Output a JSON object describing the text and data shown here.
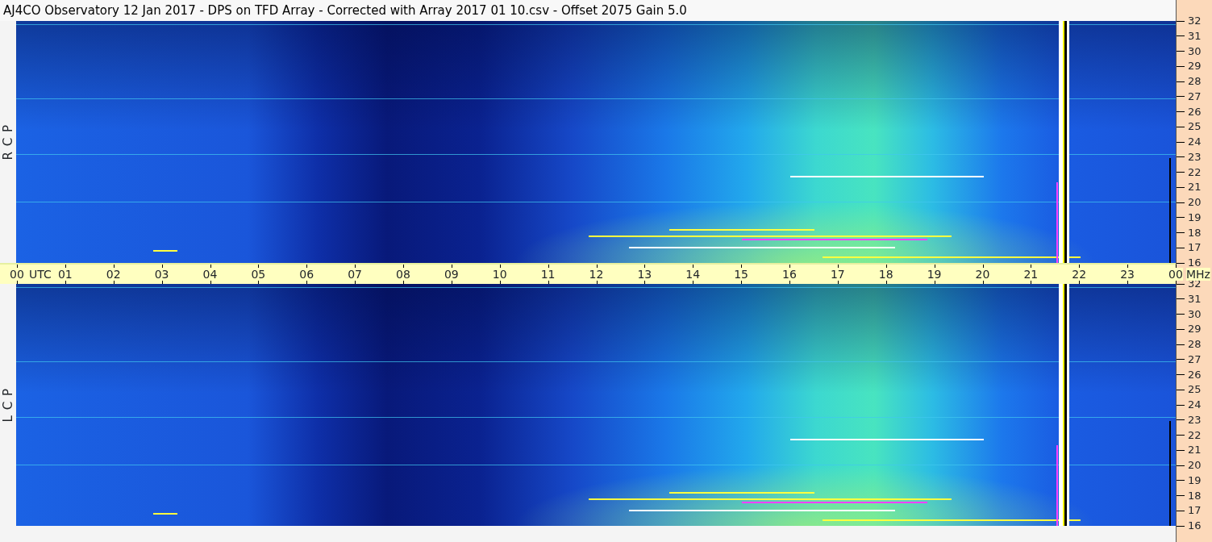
{
  "window": {
    "title": "AJ4CO Observatory  12 Jan 2017  -  DPS on TFD Array  -  Corrected with Array 2017 01 10.csv  -  Offset 2075  Gain 5.0"
  },
  "panels": [
    {
      "label": "R C P",
      "frequency_ticks": [
        "32",
        "31",
        "30",
        "29",
        "28",
        "27",
        "26",
        "25",
        "24",
        "23",
        "22",
        "21",
        "20",
        "19",
        "18",
        "17",
        "16"
      ]
    },
    {
      "label": "L C P",
      "frequency_ticks": [
        "32",
        "31",
        "30",
        "29",
        "28",
        "27",
        "26",
        "25",
        "24",
        "23",
        "22",
        "21",
        "20",
        "19",
        "18",
        "17",
        "16"
      ]
    }
  ],
  "time_axis": {
    "hours": [
      "00",
      "01",
      "02",
      "03",
      "04",
      "05",
      "06",
      "07",
      "08",
      "09",
      "10",
      "11",
      "12",
      "13",
      "14",
      "15",
      "16",
      "17",
      "18",
      "19",
      "20",
      "21",
      "22",
      "23",
      "00"
    ],
    "zone": "UTC",
    "unit": "MHz"
  }
}
